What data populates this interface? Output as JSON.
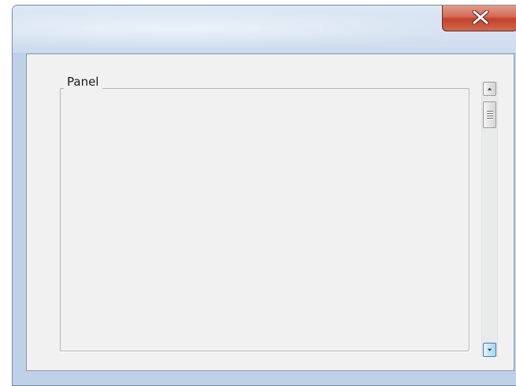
{
  "window": {
    "close_icon": "close-x-icon"
  },
  "panel": {
    "label": "Panel"
  },
  "scrollbar": {
    "up_icon": "arrow-up-icon",
    "down_icon": "arrow-down-icon",
    "thumb_icon": "grip-icon",
    "position": 0.0
  },
  "colors": {
    "close_button": "#c7432c",
    "panel_background": "#f0f1f0",
    "titlebar": "#cddcee"
  }
}
